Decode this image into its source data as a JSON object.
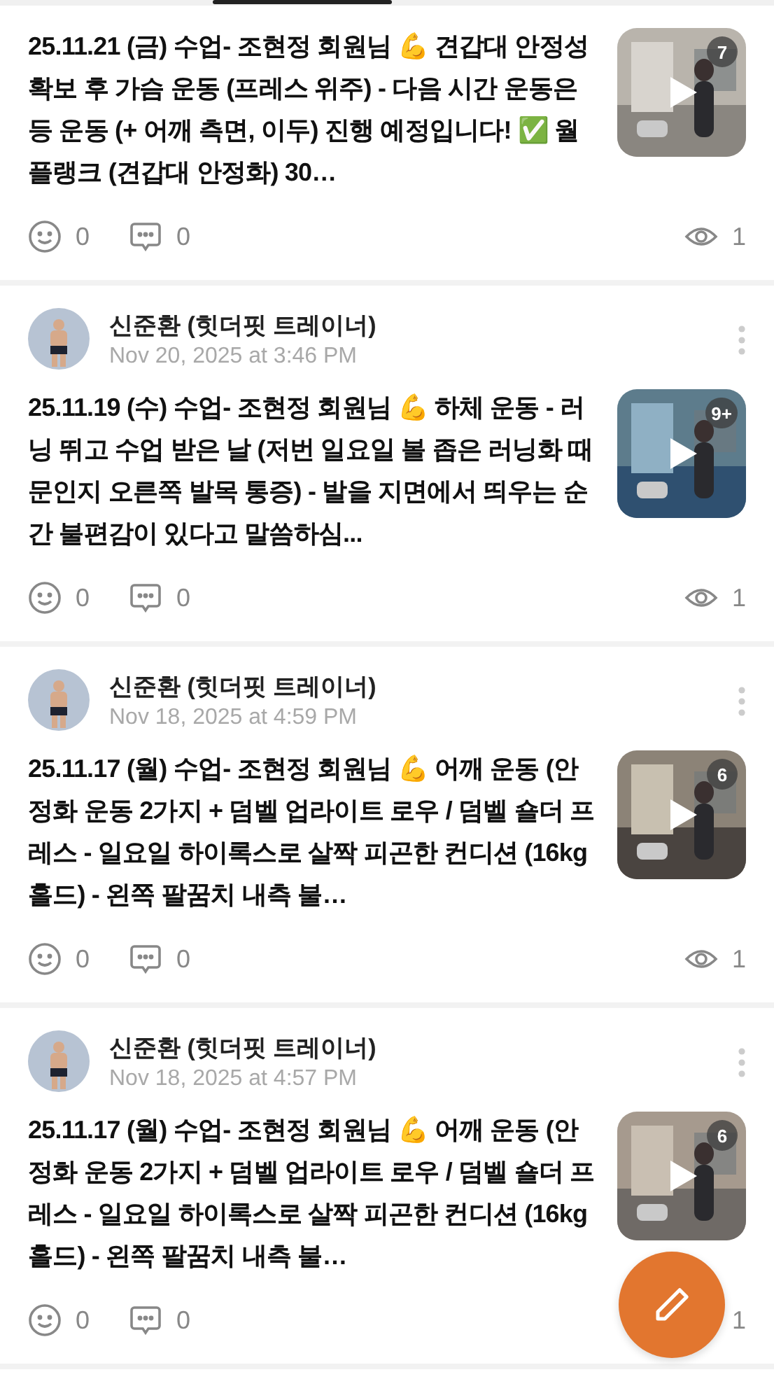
{
  "posts": [
    {
      "text": "25.11.21 (금) 수업- 조현정 회원님 💪 견갑대 안정성 확보 후 가슴 운동 (프레스 위주) - 다음 시간 운동은 등 운동 (+ 어깨 측면, 이두) 진행 예정입니다! ✅ 월 플랭크 (견갑대 안정화) 30…",
      "media_count": "7",
      "reactions": "0",
      "comments": "0",
      "views": "1"
    },
    {
      "author": "신준환 (힛더핏 트레이너)",
      "time": "Nov 20, 2025 at 3:46 PM",
      "text": "25.11.19 (수) 수업- 조현정 회원님 💪 하체 운동 - 러닝 뛰고 수업 받은 날 (저번 일요일 볼 좁은 러닝화 때문인지 오른쪽 발목 통증) - 발을 지면에서 띄우는 순간 불편감이 있다고 말씀하심...",
      "media_count": "9+",
      "reactions": "0",
      "comments": "0",
      "views": "1"
    },
    {
      "author": "신준환 (힛더핏 트레이너)",
      "time": "Nov 18, 2025 at 4:59 PM",
      "text": "25.11.17 (월) 수업- 조현정 회원님 💪 어깨 운동 (안정화 운동 2가지 + 덤벨 업라이트 로우 / 덤벨 숄더 프레스 - 일요일 하이록스로 살짝 피곤한 컨디션 (16kg 홀드) - 왼쪽 팔꿈치 내측 불…",
      "media_count": "6",
      "reactions": "0",
      "comments": "0",
      "views": "1"
    },
    {
      "author": "신준환 (힛더핏 트레이너)",
      "time": "Nov 18, 2025 at 4:57 PM",
      "text": "25.11.17 (월) 수업- 조현정 회원님 💪 어깨 운동 (안정화 운동 2가지 + 덤벨 업라이트 로우 / 덤벨 숄더 프레스 - 일요일 하이록스로 살짝 피곤한 컨디션 (16kg 홀드) - 왼쪽 팔꿈치 내측 불…",
      "media_count": "6",
      "reactions": "0",
      "comments": "0",
      "views": "1"
    }
  ]
}
